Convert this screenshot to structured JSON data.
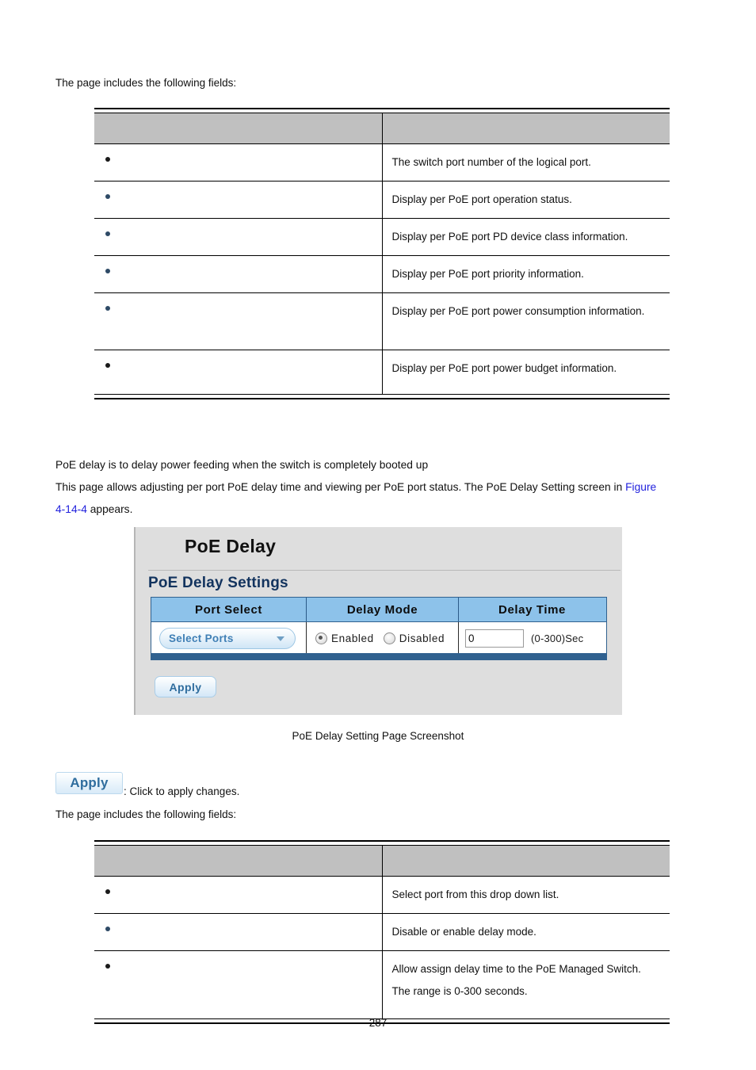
{
  "page": {
    "number": "287",
    "intro_text_top": "The page includes the following fields:",
    "intro_text_bottom": "The page includes the following fields:"
  },
  "table_top": {
    "headers": [
      "",
      ""
    ],
    "rows": [
      {
        "bullet": "•",
        "description": "The switch port number of the logical port."
      },
      {
        "bullet": "•",
        "description": "Display per PoE port operation status."
      },
      {
        "bullet": "•",
        "description": "Display per PoE port PD device class information."
      },
      {
        "bullet": "•",
        "description": "Display per PoE port priority information."
      },
      {
        "bullet": "•",
        "description": "Display per PoE port power consumption information."
      },
      {
        "bullet": "•",
        "description": "Display per PoE port power budget information."
      }
    ]
  },
  "paragraphs": {
    "line1": "PoE delay is to delay power feeding when the switch is completely booted up",
    "line2_part1": "This page allows adjusting per port PoE delay time and viewing per PoE port status. The PoE Delay Setting screen in ",
    "line2_link1": "Figure",
    "line3_link2": "4-14-4",
    "line3_part2": " appears."
  },
  "screenshot": {
    "panel_title": "PoE Delay",
    "section_title": "PoE Delay Settings",
    "columns": [
      "Port Select",
      "Delay Mode",
      "Delay Time"
    ],
    "port_select": {
      "label": "Select Ports",
      "caret_icon": "chevron-down-icon"
    },
    "delay_mode": {
      "enabled_label": "Enabled",
      "disabled_label": "Disabled",
      "selected": "Enabled"
    },
    "delay_time": {
      "value": "0",
      "placeholder": "0",
      "unit_label": "(0-300)Sec"
    },
    "apply_label": "Apply",
    "colors": {
      "panel_bg": "#dedede",
      "table_header_bg": "#8dc2ea",
      "table_border": "#30618f",
      "section_title": "#12335e",
      "accent_blue": "#2f6d9e"
    }
  },
  "caption": "PoE Delay Setting Page Screenshot",
  "legend": {
    "apply_button_label": "Apply",
    "apply_description": ": Click to apply changes."
  },
  "table_bottom": {
    "headers": [
      "",
      ""
    ],
    "rows": [
      {
        "bullet": "•",
        "description": "Select port from this drop down list."
      },
      {
        "bullet": "•",
        "description": "Disable or enable delay mode."
      },
      {
        "bullet": "•",
        "description": "Allow assign delay time to the PoE Managed Switch. The range is 0-300 seconds."
      }
    ]
  }
}
